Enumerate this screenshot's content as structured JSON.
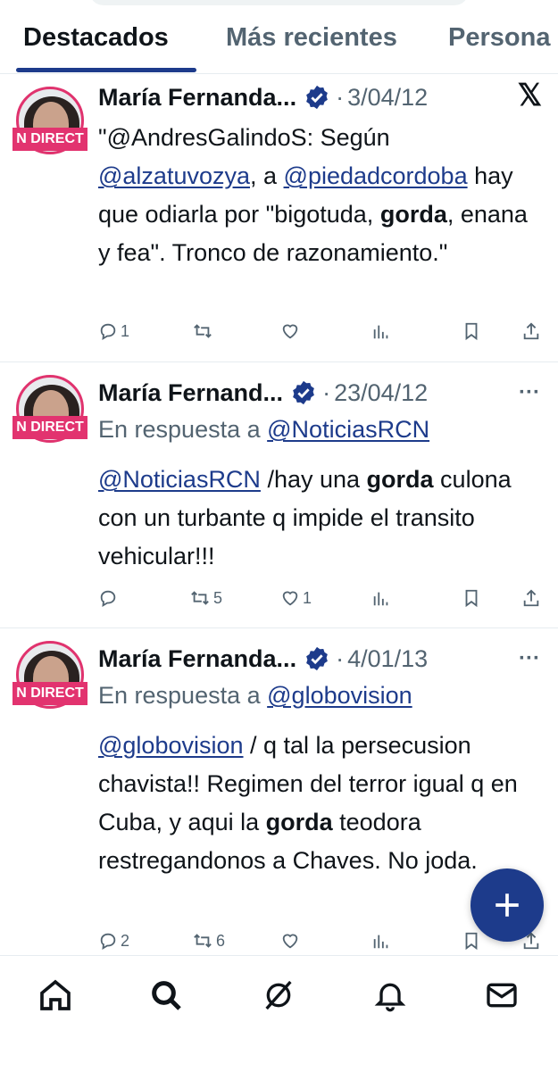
{
  "tabs": [
    {
      "label": "Destacados"
    },
    {
      "label": "Más recientes"
    },
    {
      "label": "Persona"
    }
  ],
  "avatar_badge": "N DIRECT",
  "tweets": [
    {
      "name": "María Fernanda...",
      "date": "3/04/12",
      "corner": "x-logo",
      "body_segments": [
        {
          "t": "\"@AndresGalindoS: Según "
        },
        {
          "t": "@alzatuvozya",
          "link": true
        },
        {
          "t": ", a "
        },
        {
          "t": "@piedadcordoba",
          "link": true
        },
        {
          "t": " hay que odiarla por \"bigotuda, "
        },
        {
          "t": "gorda",
          "bold": true
        },
        {
          "t": ", enana y fea\". Tronco de razonamiento.\""
        }
      ],
      "replies": "1",
      "retweets": "",
      "likes": ""
    },
    {
      "name": "María Fernand...",
      "date": "23/04/12",
      "corner": "more-icon",
      "reply_prefix": "En respuesta a",
      "reply_handle": "@NoticiasRCN",
      "body_segments": [
        {
          "t": "@NoticiasRCN",
          "link": true
        },
        {
          "t": " /hay una "
        },
        {
          "t": "gorda",
          "bold": true
        },
        {
          "t": " culona con un turbante q impide el transito vehicular!!!"
        }
      ],
      "replies": "",
      "retweets": "5",
      "likes": "1"
    },
    {
      "name": "María Fernanda...",
      "date": "4/01/13",
      "corner": "more-icon",
      "reply_prefix": "En respuesta a",
      "reply_handle": "@globovision",
      "body_segments": [
        {
          "t": "@globovision",
          "link": true
        },
        {
          "t": " / q tal la persecusion chavista!! Regimen del terror igual q en Cuba, y aqui la "
        },
        {
          "t": "gorda",
          "bold": true
        },
        {
          "t": " teodora restregandonos a Chaves. No joda."
        }
      ],
      "replies": "2",
      "retweets": "6",
      "likes": ""
    }
  ],
  "corner_more": "···",
  "corner_x": "𝕏",
  "colors": {
    "accent": "#1d3b8b",
    "badge": "#e2336f",
    "muted": "#536471"
  },
  "bottom_nav": [
    "home-icon",
    "search-icon",
    "grok-icon",
    "notifications-icon",
    "messages-icon"
  ]
}
